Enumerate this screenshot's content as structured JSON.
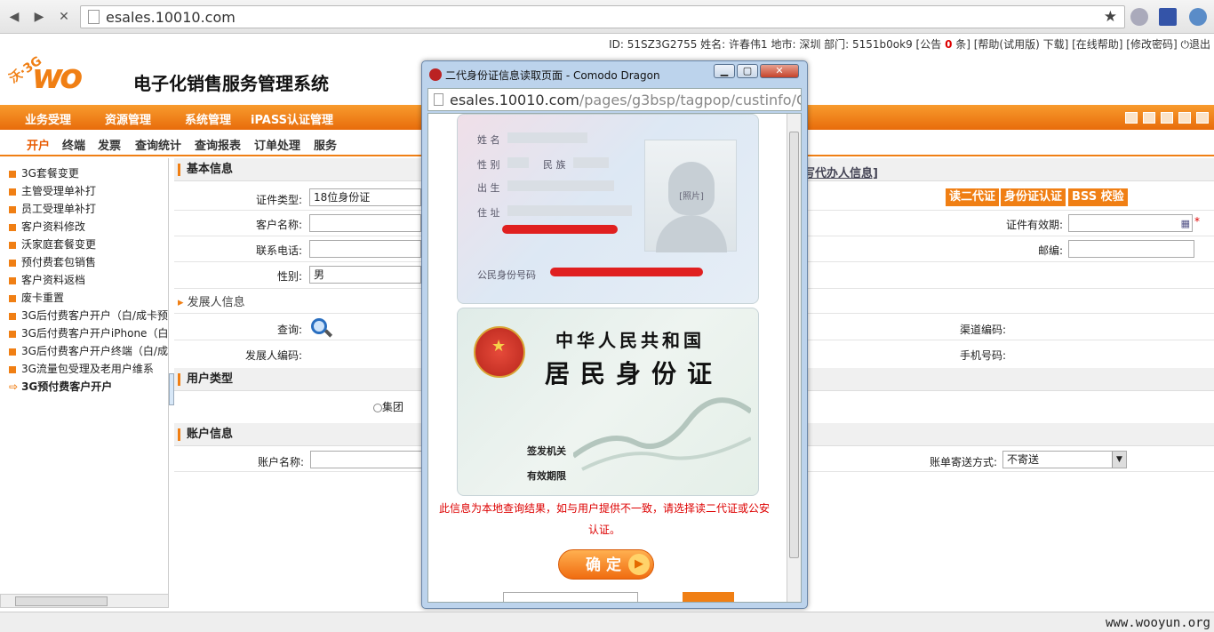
{
  "browser": {
    "url": "esales.10010.com"
  },
  "infobar": {
    "text_before": "ID: 51SZ3G2755 姓名: 许春伟1 地市: 深圳 部门: 5151b0ok9 [公告",
    "count": "0",
    "text_after": "条] [帮助(试用版) 下载] [在线帮助] [修改密码]",
    "exit": "退出"
  },
  "header": {
    "logo_text": "沃",
    "logo_tag": "沃·3G",
    "title": "电子化销售服务管理系统"
  },
  "mainnav": [
    "业务受理",
    "资源管理",
    "系统管理",
    "iPASS认证管理"
  ],
  "subnav": [
    "开户",
    "终端",
    "发票",
    "查询统计",
    "查询报表",
    "订单处理",
    "服务"
  ],
  "sidebar": [
    "3G套餐变更",
    "主管受理单补打",
    "员工受理单补打",
    "客户资料修改",
    "沃家庭套餐变更",
    "预付费套包销售",
    "客户资料返档",
    "废卡重置",
    "3G后付费客户开户（白/成卡预",
    "3G后付费客户开户iPhone（白",
    "3G后付费客户开户终端（白/成",
    "3G流量包受理及老用户维系",
    "3G预付费客户开户"
  ],
  "form": {
    "basic_title": "基本信息",
    "agent_link": "写代办人信息]",
    "cert_type_label": "证件类型:",
    "cert_type_value": "18位身份证",
    "cust_name_label": "客户名称:",
    "phone_label": "联系电话:",
    "gender_label": "性别:",
    "gender_value": "男",
    "btn_read": "读二代证",
    "btn_verify": "身份证认证",
    "btn_bss": "BSS 校验",
    "validity_label": "证件有效期:",
    "zip_label": "邮编:",
    "dev_title": "发展人信息",
    "query_label": "查询:",
    "dev_code_label": "发展人编码:",
    "channel_label": "渠道编码:",
    "mobile_label": "手机号码:",
    "user_type_title": "用户类型",
    "group_label": "集团",
    "account_title": "账户信息",
    "account_name_label": "账户名称:",
    "bill_label": "账单寄送方式:",
    "bill_value": "不寄送"
  },
  "popup": {
    "title": "二代身份证信息读取页面 - Comodo Dragon",
    "url_main": "esales.10010.com",
    "url_rest": "/pages/g3bsp/tagpop/custinfo/G3",
    "card": {
      "name_label": "姓 名",
      "gender_label": "性 别",
      "ethnic_label": "民 族",
      "birth_label": "出 生",
      "addr_label": "住 址",
      "idno_label": "公民身份号码",
      "photo_caption": "[照片]",
      "country": "中华人民共和国",
      "card_title": "居民身份证",
      "issuer_label": "签发机关",
      "valid_label": "有效期限"
    },
    "warning": "此信息为本地查询结果，如与用户提供不一致，请选择读二代证或公安认证。",
    "ok_label": "确定"
  },
  "watermark": "www.wooyun.org",
  "colors": {
    "accent": "#f07f14",
    "warning": "#dd0000"
  }
}
